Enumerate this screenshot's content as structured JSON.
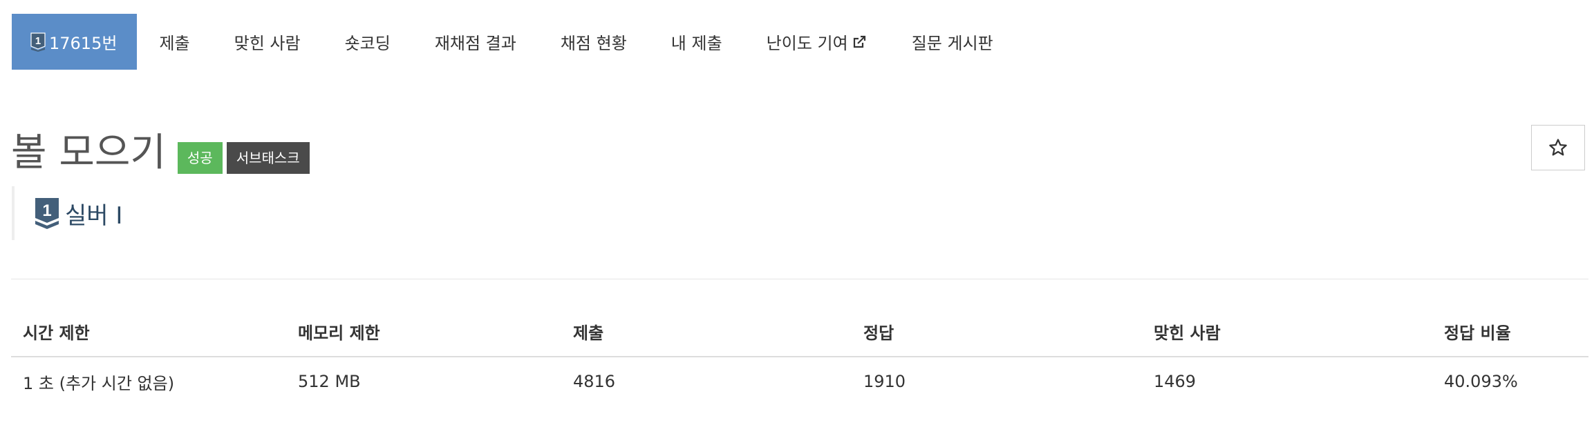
{
  "nav": {
    "problem_number": "17615번",
    "items": [
      {
        "label": "제출"
      },
      {
        "label": "맞힌 사람"
      },
      {
        "label": "숏코딩"
      },
      {
        "label": "재채점 결과"
      },
      {
        "label": "채점 현황"
      },
      {
        "label": "내 제출"
      },
      {
        "label": "난이도 기여",
        "icon": "external-link-icon"
      },
      {
        "label": "질문 게시판"
      }
    ]
  },
  "problem": {
    "title": "볼 모으기",
    "badges": {
      "success": "성공",
      "subtask": "서브태스크"
    },
    "tier": {
      "label": "실버 I",
      "icon_digit": "1",
      "icon": "tier-badge-icon"
    },
    "favorite_icon": "star-icon"
  },
  "info_table": {
    "headers": [
      "시간 제한",
      "메모리 제한",
      "제출",
      "정답",
      "맞힌 사람",
      "정답 비율"
    ],
    "row": [
      "1 초 (추가 시간 없음)",
      "512 MB",
      "4816",
      "1910",
      "1469",
      "40.093%"
    ]
  },
  "colors": {
    "nav_active": "#5b8dc8",
    "badge_success": "#5cb85c",
    "badge_subtask": "#4a4a4a",
    "tier_icon": "#435f7a"
  }
}
